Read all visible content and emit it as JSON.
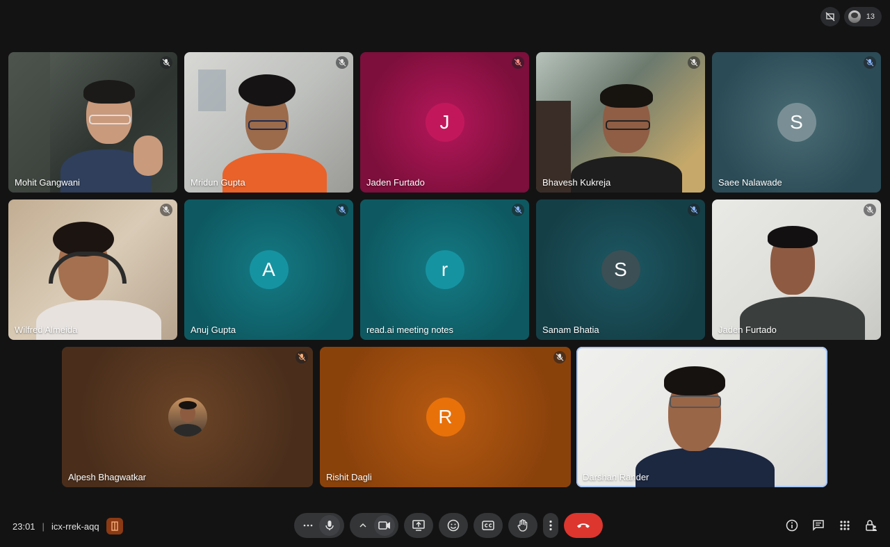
{
  "participant_count": "13",
  "tiles": [
    {
      "name": "Mohit Gangwani"
    },
    {
      "name": "Mridun Gupta"
    },
    {
      "name": "Jaden Furtado",
      "initial": "J"
    },
    {
      "name": "Bhavesh Kukreja"
    },
    {
      "name": "Saee Nalawade",
      "initial": "S"
    },
    {
      "name": "Wilfred Almeida"
    },
    {
      "name": "Anuj Gupta",
      "initial": "A"
    },
    {
      "name": "read.ai meeting notes",
      "initial": "r"
    },
    {
      "name": "Sanam Bhatia",
      "initial": "S"
    },
    {
      "name": "Jaden Furtado"
    },
    {
      "name": "Alpesh Bhagwatkar"
    },
    {
      "name": "Rishit Dagli",
      "initial": "R"
    },
    {
      "name": "Darshan Rander"
    }
  ],
  "bottom": {
    "time": "23:01",
    "separator": "|",
    "meeting_code": "icx-rrek-aqq"
  },
  "colors": {
    "background": "#131314",
    "end_call": "#dc362e",
    "active_speaker_border": "#a8c7fa"
  }
}
